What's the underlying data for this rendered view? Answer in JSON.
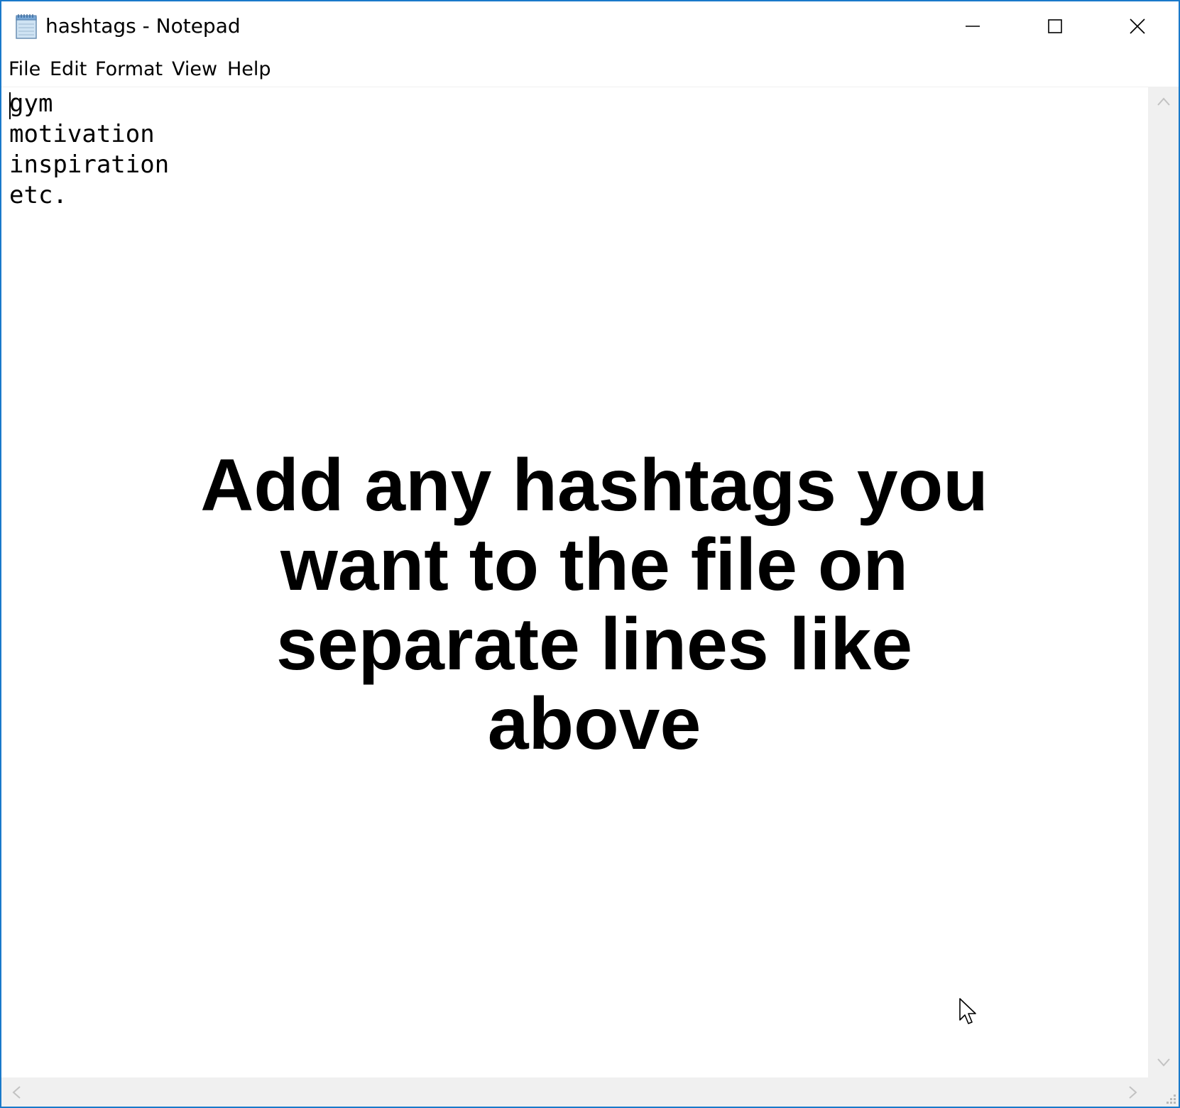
{
  "window": {
    "title": "hashtags - Notepad",
    "icon": "notepad-icon",
    "border_color": "#1979ca"
  },
  "title_buttons": {
    "minimize": "minimize-icon",
    "maximize": "maximize-icon",
    "close": "close-icon"
  },
  "menu": {
    "file": "File",
    "edit": "Edit",
    "format": "Format",
    "view": "View",
    "help": "Help"
  },
  "editor": {
    "content": "gym\nmotivation\ninspiration\netc."
  },
  "overlay": {
    "text": "Add any hashtags you want to the file on separate lines like above"
  }
}
